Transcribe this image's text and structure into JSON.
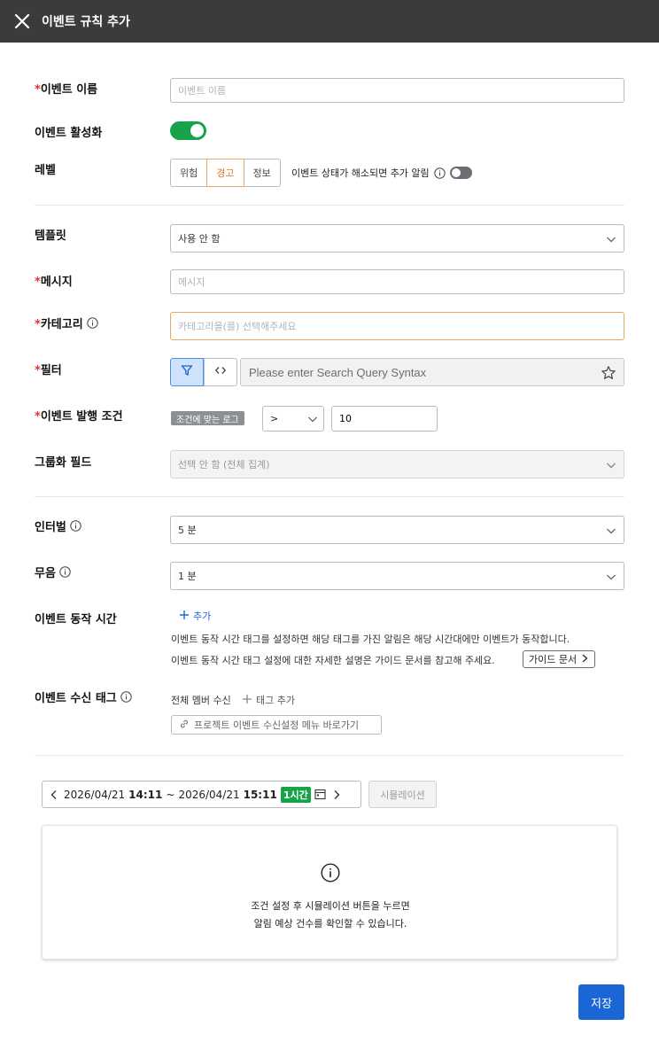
{
  "header": {
    "title": "이벤트 규칙 추가",
    "close_icon": "close-icon"
  },
  "form": {
    "event_name": {
      "label": "이벤트 이름",
      "required_mark": "*",
      "placeholder": "이벤트 이름",
      "value": ""
    },
    "activation": {
      "label": "이벤트 활성화",
      "enabled": true
    },
    "level": {
      "label": "레벨",
      "options": [
        "위험",
        "경고",
        "정보"
      ],
      "selected": "경고",
      "resolve_notice_label": "이벤트 상태가 해소되면 추가 알림",
      "resolve_notice_enabled": false
    },
    "template": {
      "label": "템플릿",
      "value": "사용 안 함"
    },
    "message": {
      "label": "메시지",
      "required_mark": "*",
      "placeholder": "메시지",
      "value": ""
    },
    "category": {
      "label": "카테고리",
      "required_mark": "*",
      "placeholder": "카테고리을(를) 선택해주세요",
      "value": ""
    },
    "filter": {
      "label": "필터",
      "required_mark": "*",
      "placeholder": "Please enter Search Query Syntax",
      "value": ""
    },
    "condition": {
      "label": "이벤트 발행 조건",
      "required_mark": "*",
      "tag": "조건에 맞는 로그",
      "operator": ">",
      "count": "10"
    },
    "group_field": {
      "label": "그룹화 필드",
      "value": "선택 안 함 (전체 집계)"
    },
    "interval": {
      "label": "인터벌",
      "value": "5 분"
    },
    "mute": {
      "label": "무음",
      "value": "1 분"
    },
    "active_time": {
      "label": "이벤트 동작 시간",
      "add_label": "추가",
      "desc_line1": "이벤트 동작 시간 태그를 설정하면 해당 태그를 가진 알림은 해당 시간대에만 이벤트가 동작합니다.",
      "desc_line2": "이벤트 동작 시간 태그 설정에 대한 자세한 설명은 가이드 문서를 참고해 주세요.",
      "guide_label": "가이드 문서"
    },
    "receive_tag": {
      "label": "이벤트 수신 태그",
      "all_members": "전체 멤버 수신",
      "add_tag_label": "태그 추가",
      "shortcut_label": "프로젝트 이벤트 수신설정 메뉴 바로가기"
    }
  },
  "simulation": {
    "start_date": "2026/04/21",
    "start_time": "14:11",
    "separator": "~",
    "end_date": "2026/04/21",
    "end_time": "15:11",
    "range_badge": "1시간",
    "button_label": "시뮬레이션",
    "message_line1": "조건 설정 후 시뮬레이션 버튼을 누르면",
    "message_line2": "알림 예상 건수를 확인할 수 있습니다."
  },
  "save_label": "저장",
  "colors": {
    "header_bg": "#3b3b3b",
    "required": "#e5322d",
    "toggle_on": "#16a34a",
    "accent_blue": "#1a66d6",
    "warning_orange": "#f0a463"
  }
}
